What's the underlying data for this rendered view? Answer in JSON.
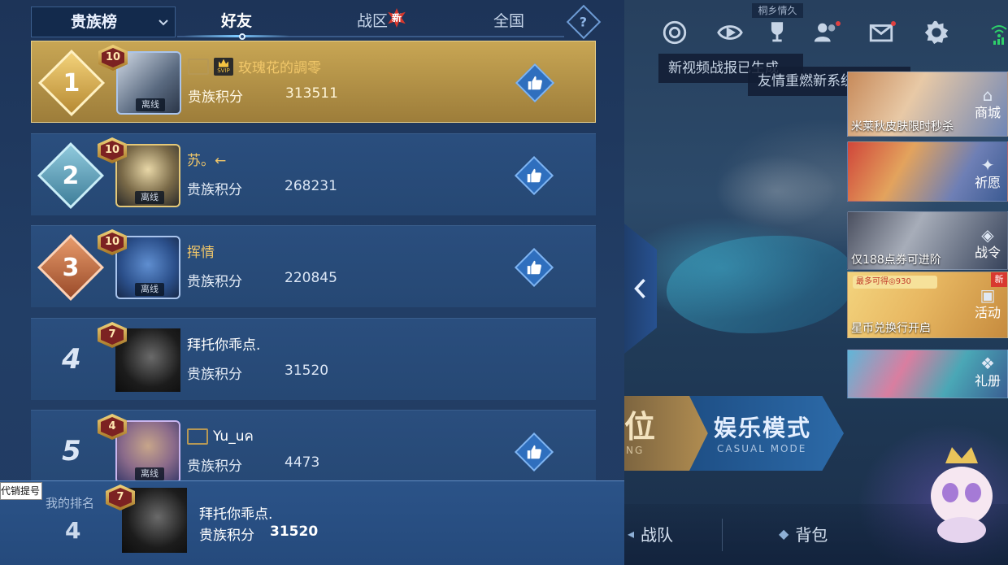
{
  "leaderboard": {
    "board_selector": "贵族榜",
    "tabs": [
      {
        "label": "好友",
        "active": true
      },
      {
        "label": "战区",
        "badge": "新"
      },
      {
        "label": "全国"
      }
    ],
    "help_glyph": "?",
    "rows": [
      {
        "rank": "1",
        "level": "10",
        "name": "玫瑰花的調零",
        "name_color": "#f1c769",
        "badges": [
          "frame-icon",
          "svip-icon"
        ],
        "svip_text": "SVIP",
        "status": "离线",
        "score_label": "贵族积分",
        "score": "313511",
        "liked": true
      },
      {
        "rank": "2",
        "level": "10",
        "name": "苏。←",
        "name_color": "#f1c769",
        "status": "离线",
        "score_label": "贵族积分",
        "score": "268231",
        "liked": true
      },
      {
        "rank": "3",
        "level": "10",
        "name": "挥情",
        "name_color": "#f1c769",
        "status": "离线",
        "score_label": "贵族积分",
        "score": "220845",
        "liked": true
      },
      {
        "rank": "4",
        "level": "7",
        "name": "拜托你乖点.",
        "name_color": "#ffffff",
        "score_label": "贵族积分",
        "score": "31520",
        "liked": false
      },
      {
        "rank": "5",
        "level": "4",
        "name": "Yu_uค",
        "name_color": "#ffffff",
        "badges": [
          "frame-icon"
        ],
        "status": "离线",
        "score_label": "贵族积分",
        "score": "4473",
        "liked": true
      }
    ],
    "my_rank": {
      "label": "我的排名",
      "rank": "4",
      "level": "7",
      "name": "拜托你乖点.",
      "score_label": "贵族积分",
      "score": "31520"
    },
    "tooltip": "代销提号"
  },
  "game_ui": {
    "hometown_tag": "桐乡情久",
    "top_icons": [
      "target-icon",
      "eye-replay-icon",
      "trophy-icon",
      "friends-icon",
      "mail-icon",
      "gear-icon"
    ],
    "toasts": [
      "新视频战报已生成",
      "友情重燃新系统上线"
    ],
    "side_panels": [
      {
        "caption": "米莱秋皮肤限时秒杀",
        "label": "商城",
        "icon": "shop-icon"
      },
      {
        "caption": "",
        "label": "祈愿",
        "icon": "wish-icon"
      },
      {
        "caption": "仅188点券可进阶",
        "label": "战令",
        "icon": "battle-pass-icon"
      },
      {
        "caption": "星币兑换行开启",
        "label": "活动",
        "icon": "activity-icon",
        "badge": "新",
        "promo": "最多可得◎930"
      },
      {
        "caption": "",
        "label": "礼册",
        "icon": "gift-book-icon"
      }
    ],
    "modes": {
      "ranked_big": "位",
      "ranked_sub": "NG",
      "casual": "娱乐模式",
      "casual_sub": "CASUAL MODE"
    },
    "bottom_nav": [
      "战队",
      "背包"
    ],
    "colors": {
      "gold_row": "#c8a654",
      "panel": "#223e66",
      "accent_blue": "#2f6fbe",
      "badge_red": "#d7372c"
    }
  }
}
